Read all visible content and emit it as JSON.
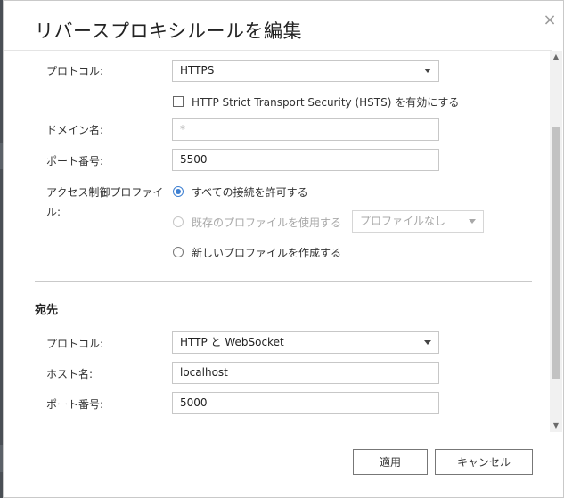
{
  "dialog": {
    "title": "リバースプロキシルールを編集",
    "close_glyph": "×"
  },
  "source": {
    "protocol_label": "プロトコル:",
    "protocol_value": "HTTPS",
    "hsts_label": "HTTP Strict Transport Security (HSTS) を有効にする",
    "hsts_checked": false,
    "domain_label": "ドメイン名:",
    "domain_value": "*",
    "port_label": "ポート番号:",
    "port_value": "5500",
    "access_label": "アクセス制御プロファイル:",
    "access_options": [
      {
        "label": "すべての接続を許可する",
        "checked": true,
        "disabled": false
      },
      {
        "label": "既存のプロファイルを使用する",
        "checked": false,
        "disabled": true
      },
      {
        "label": "新しいプロファイルを作成する",
        "checked": false,
        "disabled": false
      }
    ],
    "profile_select_value": "プロファイルなし"
  },
  "destination": {
    "section_title": "宛先",
    "protocol_label": "プロトコル:",
    "protocol_value": "HTTP と WebSocket",
    "host_label": "ホスト名:",
    "host_value": "localhost",
    "port_label": "ポート番号:",
    "port_value": "5000"
  },
  "buttons": {
    "apply": "適用",
    "cancel": "キャンセル"
  },
  "colors": {
    "accent": "#3d7fd1",
    "backdrop": "#4a4f55"
  }
}
